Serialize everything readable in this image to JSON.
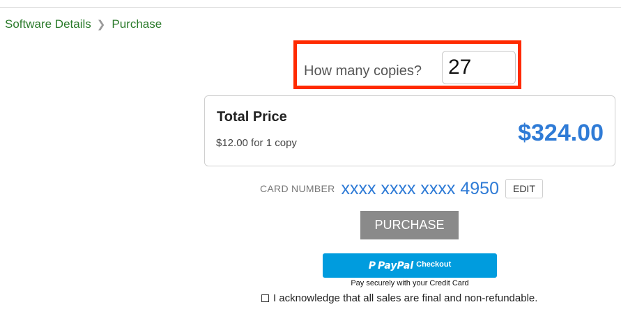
{
  "breadcrumb": {
    "items": [
      {
        "label": "Software Details"
      },
      {
        "label": "Purchase"
      }
    ],
    "separator": ">"
  },
  "copies": {
    "label": "How many copies?",
    "value": "27"
  },
  "total": {
    "title": "Total Price",
    "unit_price_text": "$12.00 for 1 copy",
    "amount": "$324.00"
  },
  "card": {
    "label": "CARD NUMBER",
    "number": "xxxx xxxx xxxx 4950",
    "edit_label": "EDIT"
  },
  "purchase": {
    "label": "PURCHASE"
  },
  "paypal": {
    "logo_letter": "P",
    "logo_text": "PayPal",
    "checkout_text": "Checkout",
    "caption": "Pay securely with your Credit Card"
  },
  "acknowledge": {
    "text": "I acknowledge that all sales are final and non-refundable."
  },
  "colors": {
    "accent_blue": "#2f7bd6",
    "breadcrumb_green": "#2a7a2a",
    "highlight_red": "#ff2a00",
    "paypal_blue": "#009cde",
    "purchase_gray": "#8a8a8a"
  }
}
